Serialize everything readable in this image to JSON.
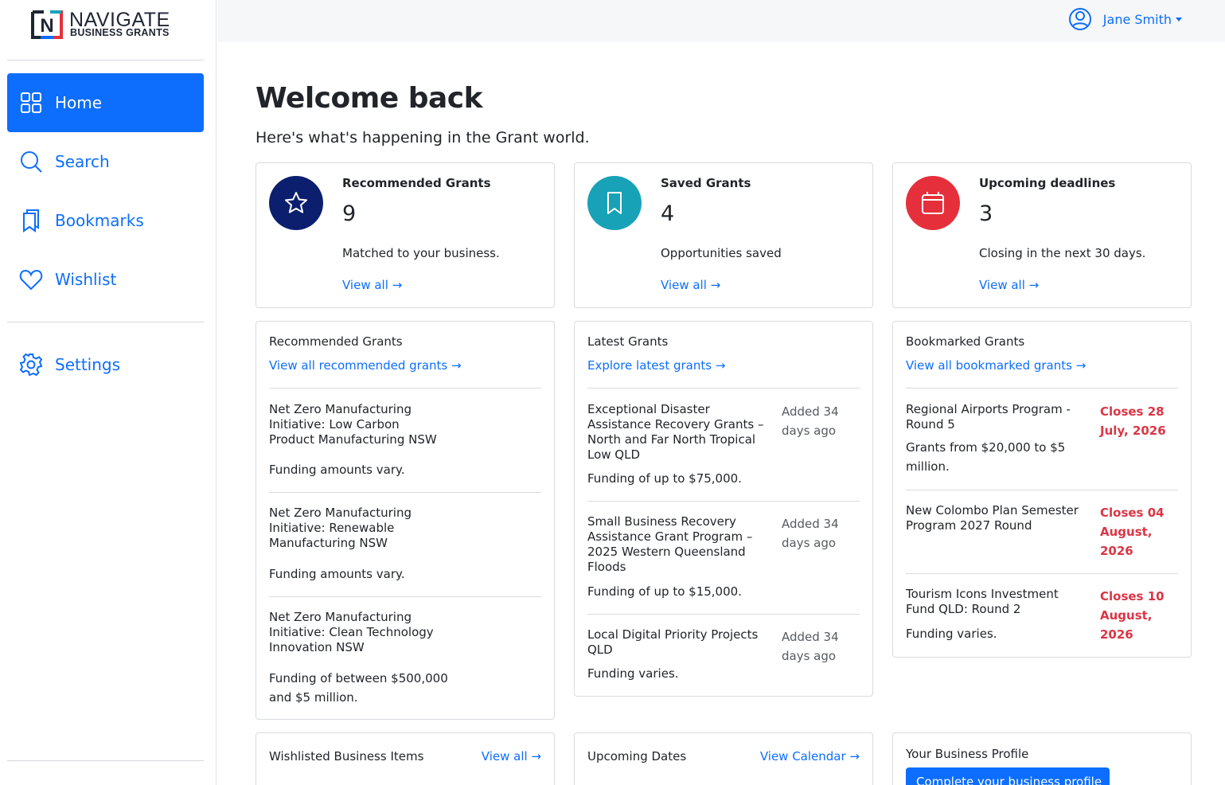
{
  "brand": {
    "word1": "NAVIGATE",
    "word2": "BUSINESS GRANTS",
    "mark_letter": "N"
  },
  "sidebar": {
    "items": [
      {
        "label": "Home",
        "icon": "grid-icon",
        "active": true
      },
      {
        "label": "Search",
        "icon": "search-icon",
        "active": false
      },
      {
        "label": "Bookmarks",
        "icon": "bookmarks-icon",
        "active": false
      },
      {
        "label": "Wishlist",
        "icon": "heart-icon",
        "active": false
      },
      {
        "label": "Settings",
        "icon": "gear-icon",
        "active": false
      }
    ]
  },
  "topbar": {
    "user_name": "Jane Smith",
    "user_icon": "user-circle-icon"
  },
  "main": {
    "title": "Welcome back",
    "subtitle": "Here's what's happening in the Grant world."
  },
  "stats": [
    {
      "title": "Recommended Grants",
      "count": "9",
      "desc": "Matched to your business.",
      "link": "View all →",
      "icon": "star-icon",
      "color": "#0b1f6e"
    },
    {
      "title": "Saved Grants",
      "count": "4",
      "desc": "Opportunities saved",
      "link": "View all →",
      "icon": "bookmark-icon",
      "color": "#17a2b8"
    },
    {
      "title": "Upcoming deadlines",
      "count": "3",
      "desc": "Closing in the next 30 days.",
      "link": "View all →",
      "icon": "calendar-icon",
      "color": "#e5303c"
    }
  ],
  "recommended": {
    "title": "Recommended Grants",
    "link": "View all recommended grants →",
    "items": [
      {
        "title": "Net Zero Manufacturing Initiative: Low Carbon Product Manufacturing NSW",
        "desc": "Funding amounts vary."
      },
      {
        "title": "Net Zero Manufacturing Initiative: Renewable Manufacturing NSW",
        "desc": "Funding amounts vary."
      },
      {
        "title": "Net Zero Manufacturing Initiative: Clean Technology Innovation NSW",
        "desc": "Funding of between $500,000 and $5 million."
      }
    ]
  },
  "latest": {
    "title": "Latest Grants",
    "link": "Explore latest grants →",
    "items": [
      {
        "title": "Exceptional Disaster Assistance Recovery Grants – North and Far North Tropical Low QLD",
        "desc": "Funding of up to $75,000.",
        "meta": "Added 34 days ago"
      },
      {
        "title": "Small Business Recovery Assistance Grant Program – 2025 Western Queensland Floods",
        "desc": "Funding of up to $15,000.",
        "meta": "Added 34 days ago"
      },
      {
        "title": "Local Digital Priority Projects QLD",
        "desc": "Funding varies.",
        "meta": "Added 34 days ago"
      }
    ]
  },
  "bookmarked": {
    "title": "Bookmarked Grants",
    "link": "View all bookmarked grants →",
    "items": [
      {
        "title": "Regional Airports Program - Round 5",
        "desc": "Grants from $20,000 to $5 million.",
        "closes": "Closes 28 July, 2026"
      },
      {
        "title": "New Colombo Plan Semester Program 2027 Round",
        "desc": "",
        "closes": "Closes 04 August, 2026"
      },
      {
        "title": "Tourism Icons Investment Fund QLD: Round 2",
        "desc": "Funding varies.",
        "closes": "Closes 10 August, 2026"
      }
    ]
  },
  "bottom": {
    "wishlist": {
      "title": "Wishlisted Business Items",
      "link": "View all →"
    },
    "dates": {
      "title": "Upcoming Dates",
      "link": "View Calendar →"
    },
    "profile": {
      "title": "Your Business Profile",
      "button": "Complete your business profile"
    }
  }
}
